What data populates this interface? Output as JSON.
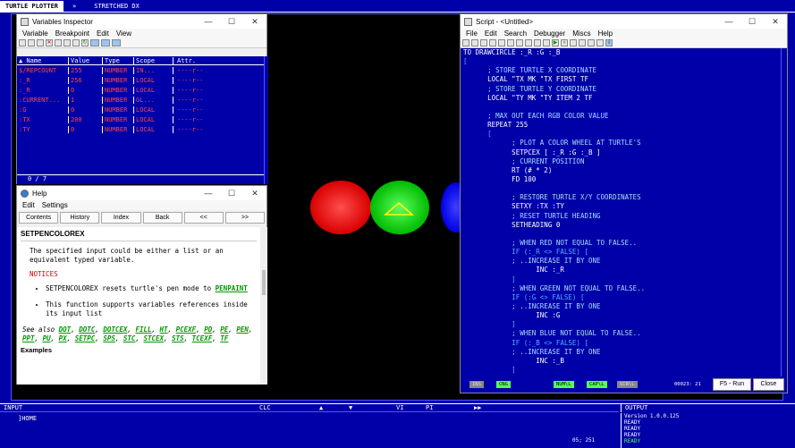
{
  "topbar": {
    "title": "TURTLE PLOTTER",
    "arrow": "»",
    "mode": "STRETCHED DX"
  },
  "variables_inspector": {
    "title": "Variables Inspector",
    "menu": [
      "Variable",
      "Breakpoint",
      "Edit",
      "View"
    ],
    "columns": [
      "Name",
      "Value",
      "Type",
      "Scope",
      "Attr."
    ],
    "rows": [
      [
        "$/REPCOUNT",
        "255",
        "NUMBER",
        "IN...",
        "----r--"
      ],
      [
        ":_R",
        "256",
        "NUMBER",
        "LOCAL",
        "----r--"
      ],
      [
        ":_R",
        "0",
        "NUMBER",
        "LOCAL",
        "----r--"
      ],
      [
        ":CURRENT...",
        "1",
        "NUMBER",
        "GL...",
        "----r--"
      ],
      [
        ":G",
        "0",
        "NUMBER",
        "LOCAL",
        "----r--"
      ],
      [
        ":TX",
        "200",
        "NUMBER",
        "LOCAL",
        "----r--"
      ],
      [
        ":TY",
        "0",
        "NUMBER",
        "LOCAL",
        "----r--"
      ]
    ],
    "status": "0 / 7"
  },
  "help": {
    "title": "Help",
    "menu": [
      "Edit",
      "Settings"
    ],
    "buttons": [
      "Contents",
      "History",
      "Index",
      "Back",
      "<<",
      ">>"
    ],
    "heading": "SETPENCOLOREX",
    "intro": "The specified input could be either a list or an equivalent typed variable.",
    "notices_label": "NOTICES",
    "notice1_pre": "SETPENCOLOREX resets turtle's pen mode to",
    "notice1_link": "PENPAINT",
    "notice2": "This function supports variables references inside its input list",
    "see_also_label": "See also",
    "see_also": [
      "DOT",
      "DOTC",
      "DOTCEX",
      "FILL",
      "HT",
      "PCEXF",
      "PD",
      "PE",
      "PEN",
      "PPT",
      "PU",
      "PX",
      "SETPC",
      "SPS",
      "STC",
      "STCEX",
      "STS",
      "TCEXF",
      "TF"
    ],
    "examples_label": "Examples"
  },
  "script": {
    "title": "Script - <Untitled>",
    "menu": [
      "File",
      "Edit",
      "Search",
      "Debugger",
      "Miscs",
      "Help"
    ],
    "lines": [
      "TO DRAWCIRCLE :_R :G :_B",
      "[",
      "      ; STORE TURTLE X COORDINATE",
      "      LOCAL \"TX MK \"TX FIRST TF",
      "      ; STORE TURTLE Y COORDINATE",
      "      LOCAL \"TY MK \"TY ITEM 2 TF",
      "",
      "      ; MAX OUT EACH RGB COLOR VALUE",
      "      REPEAT 255",
      "      [",
      "            ; PLOT A COLOR WHEEL AT TURTLE'S",
      "            SETPCEX [ :_R :G :_B ]",
      "            ; CURRENT POSITION",
      "            RT (# * 2)",
      "            FD 100",
      "",
      "            ; RESTORE TURTLE X/Y COORDINATES",
      "            SETXY :TX :TY",
      "            ; RESET TURTLE HEADING",
      "            SETHEADING 0",
      "",
      "            ; WHEN RED NOT EQUAL TO FALSE..",
      "            IF (:_R <> FALSE) [",
      "            ; ..INCREASE IT BY ONE",
      "                  INC :_R",
      "            ]",
      "            ; WHEN GREEN NOT EQUAL TO FALSE..",
      "            IF (:G <> FALSE) [",
      "            ; ..INCREASE IT BY ONE",
      "                  INC :G",
      "            ]",
      "            ; WHEN BLUE NOT EQUAL TO FALSE..",
      "            IF (:_B <> FALSE) [",
      "            ; ..INCREASE IT BY ONE",
      "                  INC :_B",
      "            ]"
    ],
    "status": {
      "ins": "INS",
      "cng": "CNG",
      "numl": "NUM\\L",
      "capl": "CAP\\L",
      "scrl": "SCR\\L",
      "pos": "00023: 21"
    },
    "run_label": "F5 - Run",
    "close_label": "Close"
  },
  "input": {
    "label": "INPUT",
    "clc": "CLC",
    "up": "▲",
    "down": "▼",
    "vi": "VI",
    "pi": "PI",
    "ff": "▶▶",
    "line": "]HOME",
    "cursor": "05; 251"
  },
  "output": {
    "label": "OUTPUT",
    "lines": [
      "Version 1.0.0.125",
      "READY",
      "READY",
      "READY",
      "READY"
    ]
  },
  "colors": {
    "bg_blue": "#0000a8",
    "red_wheel": "#ff2020",
    "green_wheel": "#20e020",
    "blue_wheel": "#2020ff"
  }
}
